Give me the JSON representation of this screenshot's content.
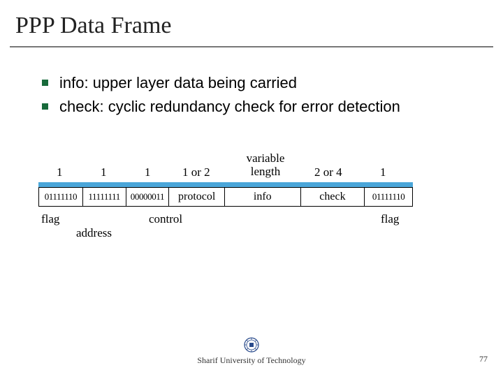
{
  "title": "PPP Data Frame",
  "bullets": [
    "info: upper layer data being carried",
    "check:  cyclic redundancy check for error detection"
  ],
  "diagram": {
    "top": [
      "1",
      "1",
      "1",
      "1 or 2",
      "variable length",
      "2 or 4",
      "1"
    ],
    "fields": [
      "01111110",
      "11111111",
      "00000011",
      "protocol",
      "info",
      "check",
      "01111110"
    ],
    "bottom": {
      "flag1": "flag",
      "address": "address",
      "control": "control",
      "flag2": "flag"
    }
  },
  "footer": {
    "org": "Sharif University of Technology"
  },
  "page": "77"
}
